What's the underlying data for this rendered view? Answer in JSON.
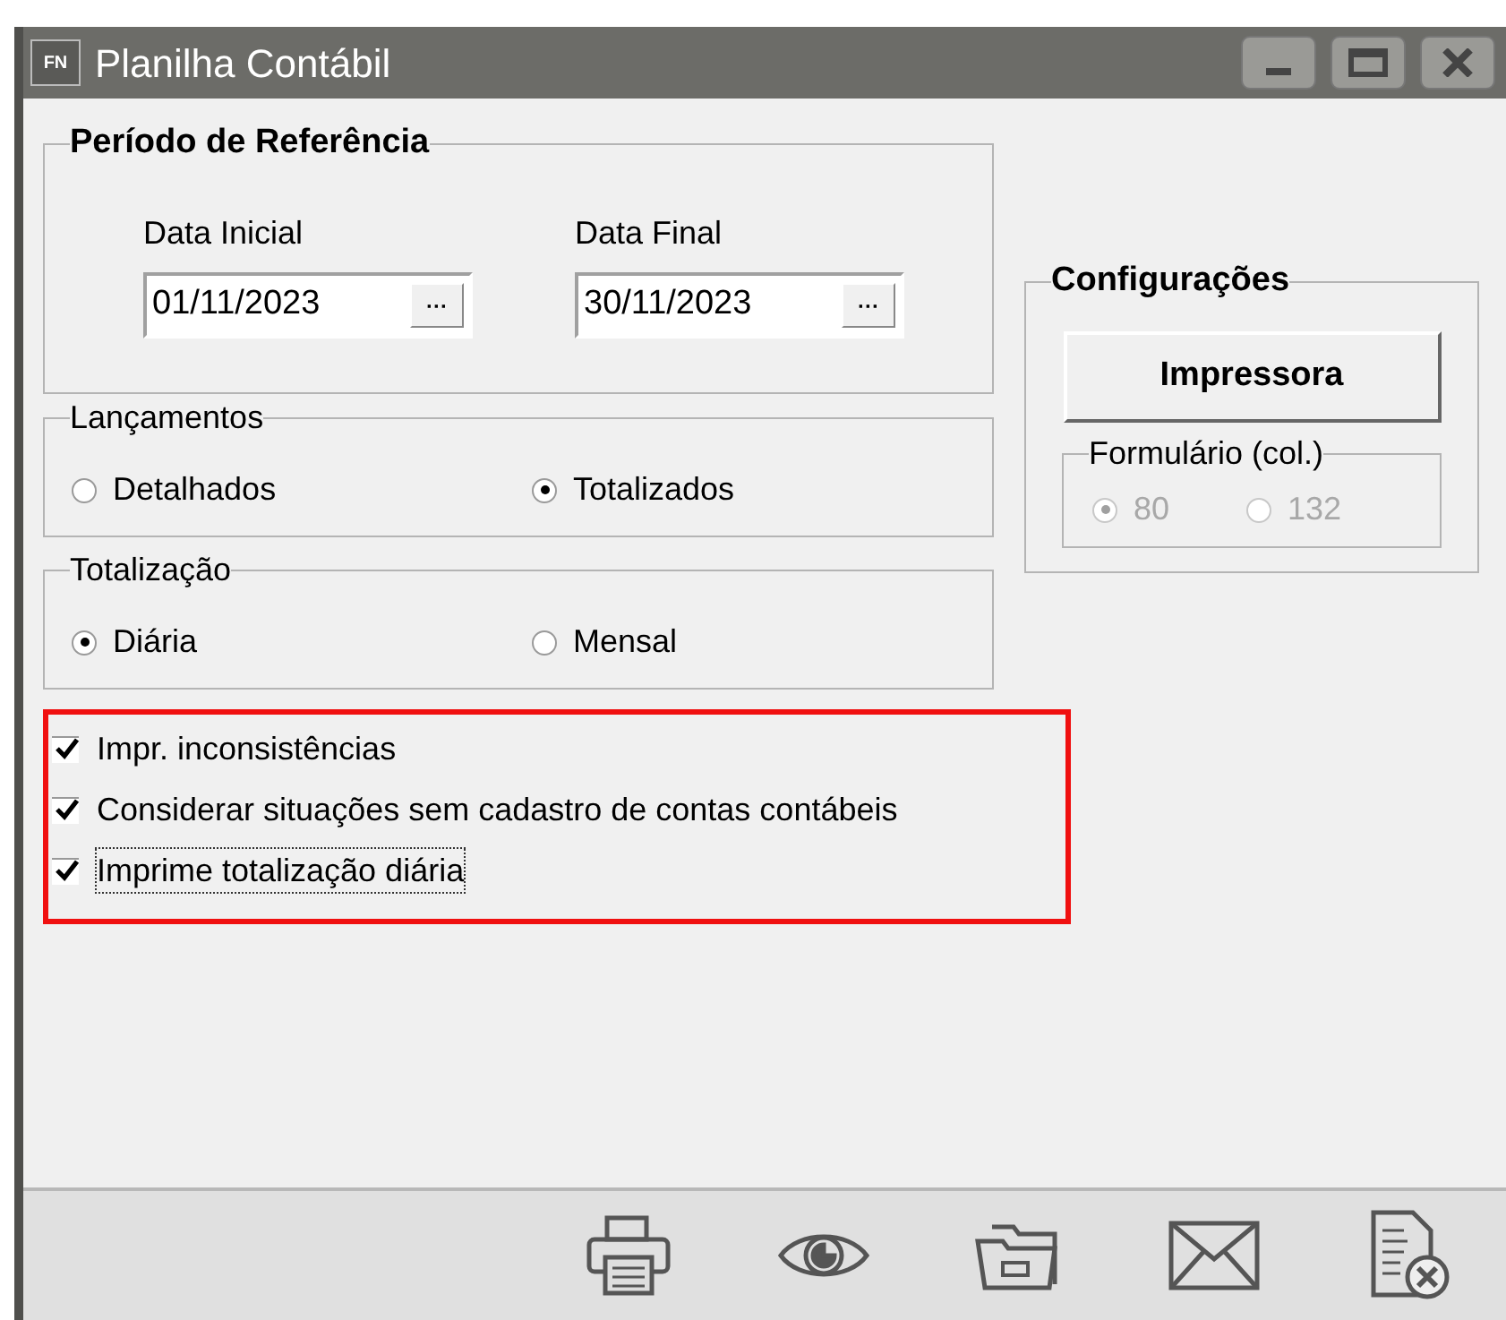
{
  "window": {
    "icon_text": "FN",
    "title": "Planilha Contábil"
  },
  "periodo": {
    "title": "Período de Referência",
    "fields": [
      {
        "label": "Data Inicial",
        "value": "01/11/2023",
        "button": "···"
      },
      {
        "label": "Data Final",
        "value": "30/11/2023",
        "button": "···"
      }
    ]
  },
  "lancamentos": {
    "title": "Lançamentos",
    "options": [
      {
        "label": "Detalhados",
        "selected": false
      },
      {
        "label": "Totalizados",
        "selected": true
      }
    ]
  },
  "totalizacao": {
    "title": "Totalização",
    "options": [
      {
        "label": "Diária",
        "selected": true
      },
      {
        "label": "Mensal",
        "selected": false
      }
    ]
  },
  "checks": [
    {
      "label": "Impr. inconsistências",
      "checked": true,
      "focused": false
    },
    {
      "label": "Considerar situações sem cadastro de contas contábeis",
      "checked": true,
      "focused": false
    },
    {
      "label": "Imprime totalização diária",
      "checked": true,
      "focused": true
    }
  ],
  "configuracoes": {
    "title": "Configurações",
    "button": "Impressora",
    "formulario": {
      "title": "Formulário (col.)",
      "disabled": true,
      "options": [
        {
          "label": "80",
          "selected": true
        },
        {
          "label": "132",
          "selected": false
        }
      ]
    }
  },
  "toolbar": [
    {
      "kind": "print"
    },
    {
      "kind": "view"
    },
    {
      "kind": "folder"
    },
    {
      "kind": "mail"
    },
    {
      "kind": "close-doc"
    }
  ]
}
